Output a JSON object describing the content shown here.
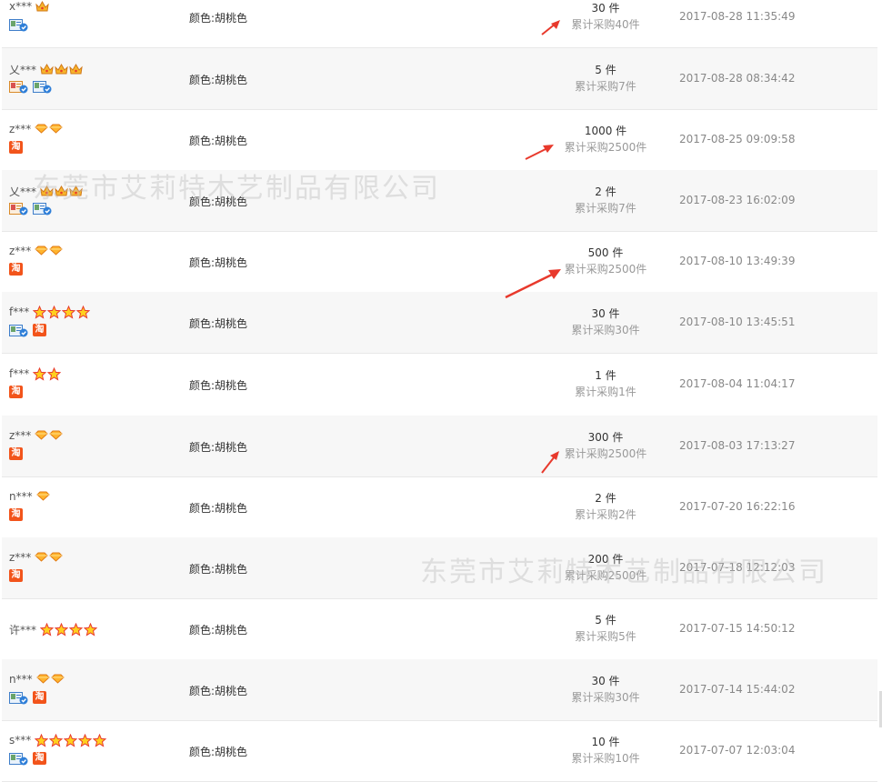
{
  "watermarks": [
    "东莞市艾莉特木艺制品有限公司",
    "东莞市艾莉特木艺制品有限公司"
  ],
  "colors": {
    "accent_red": "#e8392c",
    "tao_orange": "#f2541b",
    "row_alt": "#f7f7f7"
  },
  "records": [
    {
      "buyer": "x***",
      "level": "crown",
      "level_count": 1,
      "badges": [
        "verified-card-icon"
      ],
      "spec": "颜色:胡桃色",
      "qty": "30 件",
      "total": "累计采购40件",
      "time": "2017-08-28 11:35:49"
    },
    {
      "buyer": "乂***",
      "level": "crown",
      "level_count": 3,
      "badges": [
        "merchant-card-icon",
        "verified-card-icon"
      ],
      "spec": "颜色:胡桃色",
      "qty": "5 件",
      "total": "累计采购7件",
      "time": "2017-08-28 08:34:42"
    },
    {
      "buyer": "z***",
      "level": "diamond",
      "level_count": 2,
      "badges": [
        "tao-icon"
      ],
      "spec": "颜色:胡桃色",
      "qty": "1000 件",
      "total": "累计采购2500件",
      "time": "2017-08-25 09:09:58"
    },
    {
      "buyer": "乂***",
      "level": "crown",
      "level_count": 3,
      "badges": [
        "merchant-card-icon",
        "verified-card-icon"
      ],
      "spec": "颜色:胡桃色",
      "qty": "2 件",
      "total": "累计采购7件",
      "time": "2017-08-23 16:02:09"
    },
    {
      "buyer": "z***",
      "level": "diamond",
      "level_count": 2,
      "badges": [
        "tao-icon"
      ],
      "spec": "颜色:胡桃色",
      "qty": "500 件",
      "total": "累计采购2500件",
      "time": "2017-08-10 13:49:39"
    },
    {
      "buyer": "f***",
      "level": "star",
      "level_count": 4,
      "badges": [
        "verified-card-icon",
        "tao-icon"
      ],
      "spec": "颜色:胡桃色",
      "qty": "30 件",
      "total": "累计采购30件",
      "time": "2017-08-10 13:45:51"
    },
    {
      "buyer": "f***",
      "level": "star",
      "level_count": 2,
      "badges": [
        "tao-icon"
      ],
      "spec": "颜色:胡桃色",
      "qty": "1 件",
      "total": "累计采购1件",
      "time": "2017-08-04 11:04:17"
    },
    {
      "buyer": "z***",
      "level": "diamond",
      "level_count": 2,
      "badges": [
        "tao-icon"
      ],
      "spec": "颜色:胡桃色",
      "qty": "300 件",
      "total": "累计采购2500件",
      "time": "2017-08-03 17:13:27"
    },
    {
      "buyer": "n***",
      "level": "diamond",
      "level_count": 1,
      "badges": [
        "tao-icon"
      ],
      "spec": "颜色:胡桃色",
      "qty": "2 件",
      "total": "累计采购2件",
      "time": "2017-07-20 16:22:16"
    },
    {
      "buyer": "z***",
      "level": "diamond",
      "level_count": 2,
      "badges": [
        "tao-icon"
      ],
      "spec": "颜色:胡桃色",
      "qty": "200 件",
      "total": "累计采购2500件",
      "time": "2017-07-18 12:12:03"
    },
    {
      "buyer": "许***",
      "level": "star",
      "level_count": 4,
      "badges": [],
      "spec": "颜色:胡桃色",
      "qty": "5 件",
      "total": "累计采购5件",
      "time": "2017-07-15 14:50:12"
    },
    {
      "buyer": "n***",
      "level": "diamond",
      "level_count": 2,
      "badges": [
        "verified-card-icon",
        "tao-icon"
      ],
      "spec": "颜色:胡桃色",
      "qty": "30 件",
      "total": "累计采购30件",
      "time": "2017-07-14 15:44:02"
    },
    {
      "buyer": "s***",
      "level": "star",
      "level_count": 5,
      "badges": [
        "verified-card-icon",
        "tao-icon"
      ],
      "spec": "颜色:胡桃色",
      "qty": "10 件",
      "total": "累计采购10件",
      "time": "2017-07-07 12:03:04"
    }
  ],
  "tao_label": "淘"
}
